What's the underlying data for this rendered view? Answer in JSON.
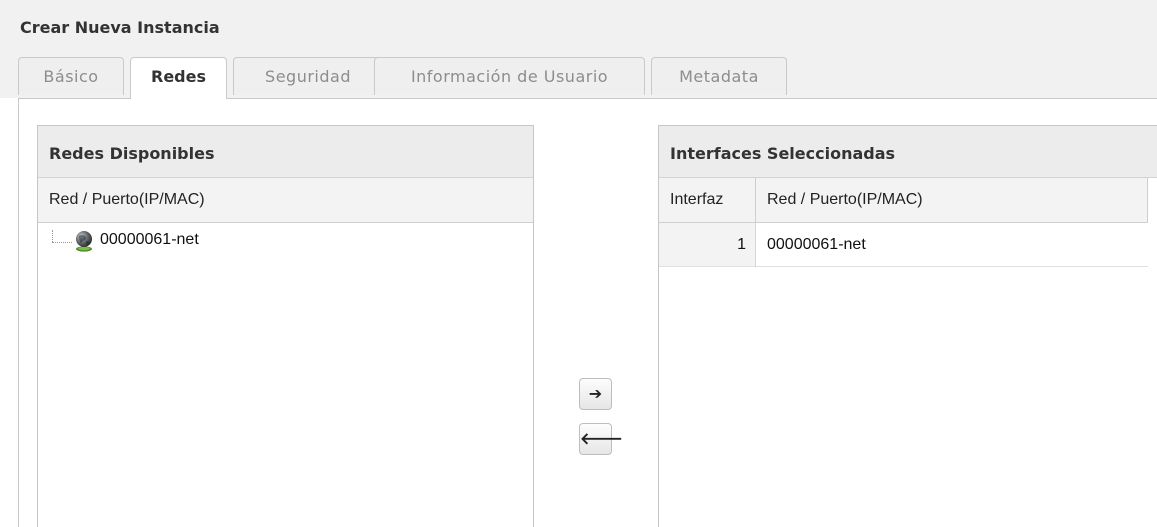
{
  "window": {
    "title": "Crear Nueva Instancia"
  },
  "tabs": [
    {
      "label": "Básico",
      "active": false
    },
    {
      "label": "Redes",
      "active": true
    },
    {
      "label": "Seguridad",
      "active": false
    },
    {
      "label": "Información de Usuario",
      "active": false
    },
    {
      "label": "Metadata",
      "active": false
    }
  ],
  "available_networks": {
    "title": "Redes Disponibles",
    "column": "Red / Puerto(IP/MAC)",
    "items": [
      {
        "icon": "globe-network-icon",
        "label": "00000061-net"
      }
    ]
  },
  "transfer_buttons": {
    "add_icon": "arrow-right-icon",
    "add_glyph": "➔",
    "remove_icon": "arrow-left-icon",
    "remove_glyph": "🡐"
  },
  "selected_interfaces": {
    "title": "Interfaces Seleccionadas",
    "columns": [
      "Interfaz",
      "Red / Puerto(IP/MAC)"
    ],
    "rows": [
      {
        "interface": "1",
        "network": "00000061-net"
      }
    ]
  }
}
